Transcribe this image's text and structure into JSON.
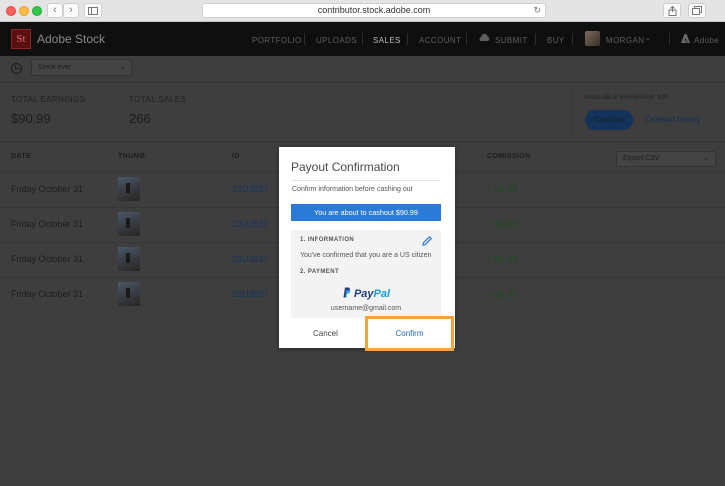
{
  "browser": {
    "url": "contributor.stock.adobe.com",
    "back_icon": "chevron-left-icon",
    "forward_icon": "chevron-right-icon"
  },
  "header": {
    "logo_text": "St",
    "brand": "Adobe Stock",
    "nav": [
      "PORTFOLIO",
      "UPLOADS",
      "SALES",
      "ACCOUNT",
      "SUBMIT",
      "BUY"
    ],
    "active_nav": "SALES",
    "user_name": "MORGAN",
    "adobe_label": "Adobe"
  },
  "filter": {
    "period": "Since ever"
  },
  "stats": {
    "total_earnings_label": "TOTAL EARNINGS",
    "total_earnings_value": "$90.99",
    "total_sales_label": "TOTAL SALES",
    "total_sales_value": "266",
    "available_label": "AVAILABLE EARNINGS: $90",
    "cashout_button": "Cashout",
    "cashout_history_link": "Cashout history"
  },
  "table": {
    "headers": {
      "date": "DATE",
      "thumb": "THUMB",
      "id": "ID",
      "commission": "COMISSION"
    },
    "export_label": "Export CSV",
    "rows": [
      {
        "date": "Friday October 31",
        "id": "23U3837",
        "commission": "+ $6,99"
      },
      {
        "date": "Friday October 31",
        "id": "23U3837",
        "commission": "+ $6,99"
      },
      {
        "date": "Friday October 31",
        "id": "23U3837",
        "commission": "+ $6,99"
      },
      {
        "date": "Friday October 31",
        "id": "23U3837",
        "commission": "+ $6,99"
      }
    ]
  },
  "modal": {
    "title": "Payout Confirmation",
    "subtitle": "Confirm information before cashing out",
    "banner": "You are about to cashout $90.99",
    "section1": "1. INFORMATION",
    "section1_text": "You've confirmed that you are a US citizen",
    "section2": "2. PAYMENT",
    "paypal_pay": "Pay",
    "paypal_pal": "Pal",
    "email": "username@gmail.com",
    "cancel": "Cancel",
    "confirm": "Confirm"
  },
  "colors": {
    "primary_blue": "#2c7ad8",
    "highlight_orange": "#f0a43a",
    "paypal_dark": "#253b80",
    "paypal_light": "#179bd7"
  }
}
